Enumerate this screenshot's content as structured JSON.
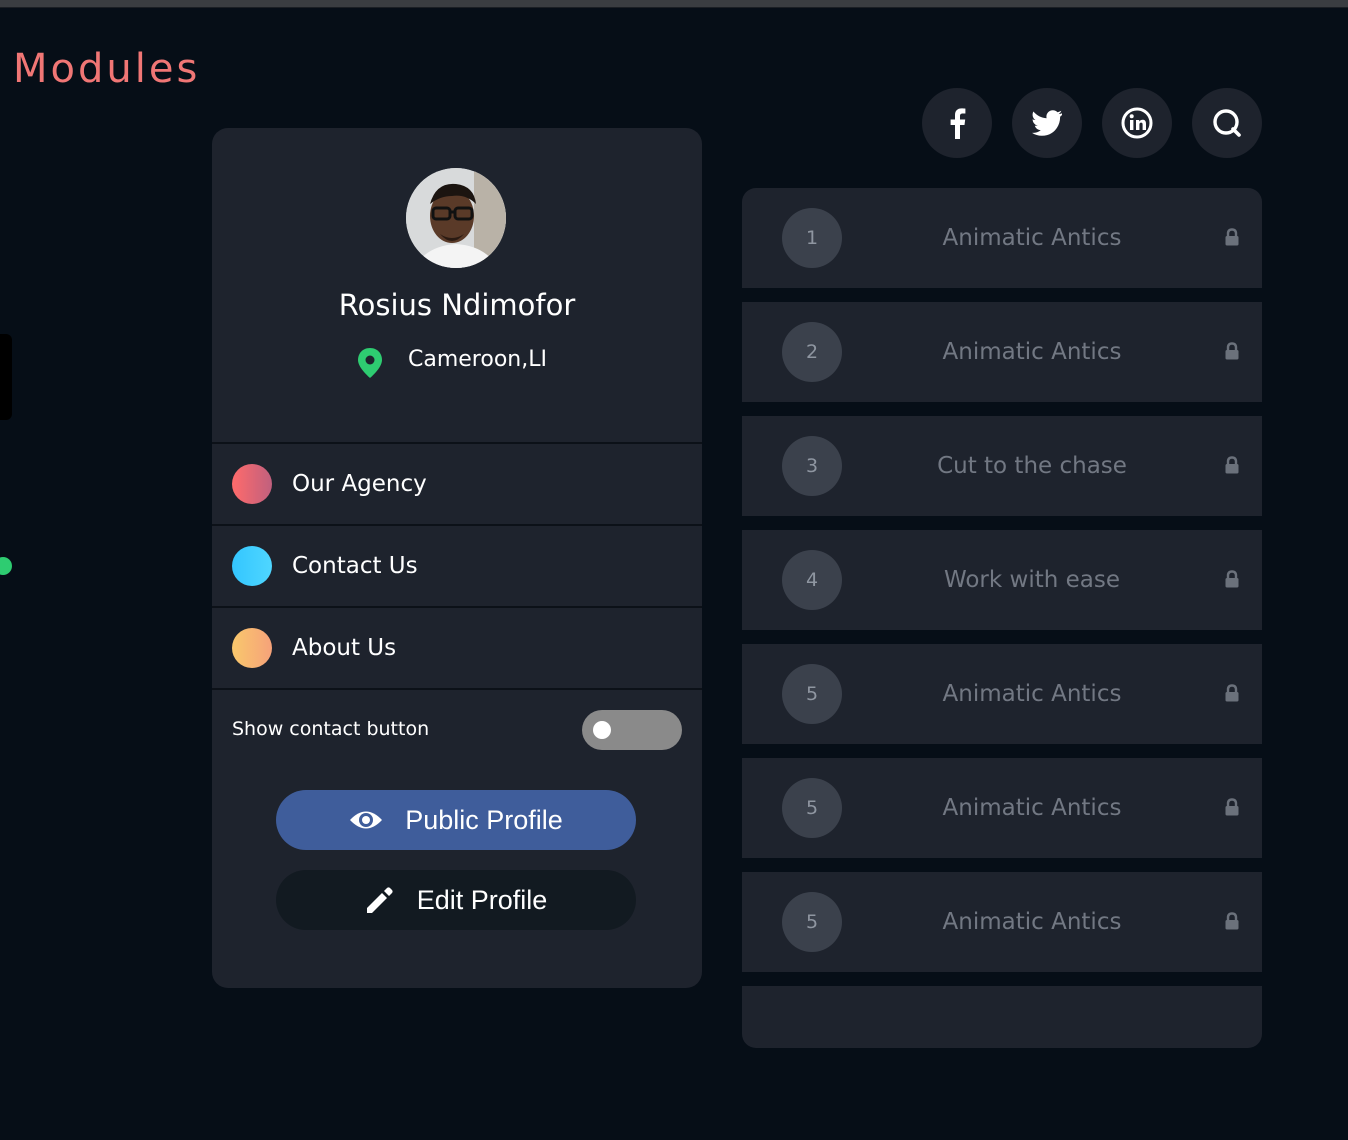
{
  "page": {
    "title": "Modules"
  },
  "profile": {
    "name": "Rosius Ndimofor",
    "location": "Cameroon,LI",
    "menu": [
      {
        "label": "Our Agency",
        "gradient": [
          "#ff6b6b",
          "#c0607e"
        ]
      },
      {
        "label": "Contact Us",
        "gradient": [
          "#33c6ff",
          "#4fd6ff"
        ]
      },
      {
        "label": "About Us",
        "gradient": [
          "#f9c86c",
          "#f6a27a"
        ]
      }
    ],
    "contact_toggle": {
      "label": "Show contact button",
      "on": false
    },
    "public_profile_label": "Public Profile",
    "edit_profile_label": "Edit Profile"
  },
  "social": [
    "facebook-icon",
    "twitter-icon",
    "linkedin-icon",
    "search-icon"
  ],
  "modules": [
    {
      "number": "1",
      "title": "Animatic Antics",
      "locked": true
    },
    {
      "number": "2",
      "title": "Animatic Antics",
      "locked": true
    },
    {
      "number": "3",
      "title": "Cut to the chase",
      "locked": true
    },
    {
      "number": "4",
      "title": "Work with ease",
      "locked": true
    },
    {
      "number": "5",
      "title": "Animatic Antics",
      "locked": true
    },
    {
      "number": "5",
      "title": "Animatic Antics",
      "locked": true
    },
    {
      "number": "5",
      "title": "Animatic Antics",
      "locked": true
    }
  ],
  "colors": {
    "accent": "#f07675",
    "location_pin": "#2ecc71",
    "public_button": "#3f5d9b",
    "card": "#1e232d",
    "background": "#060e17"
  }
}
